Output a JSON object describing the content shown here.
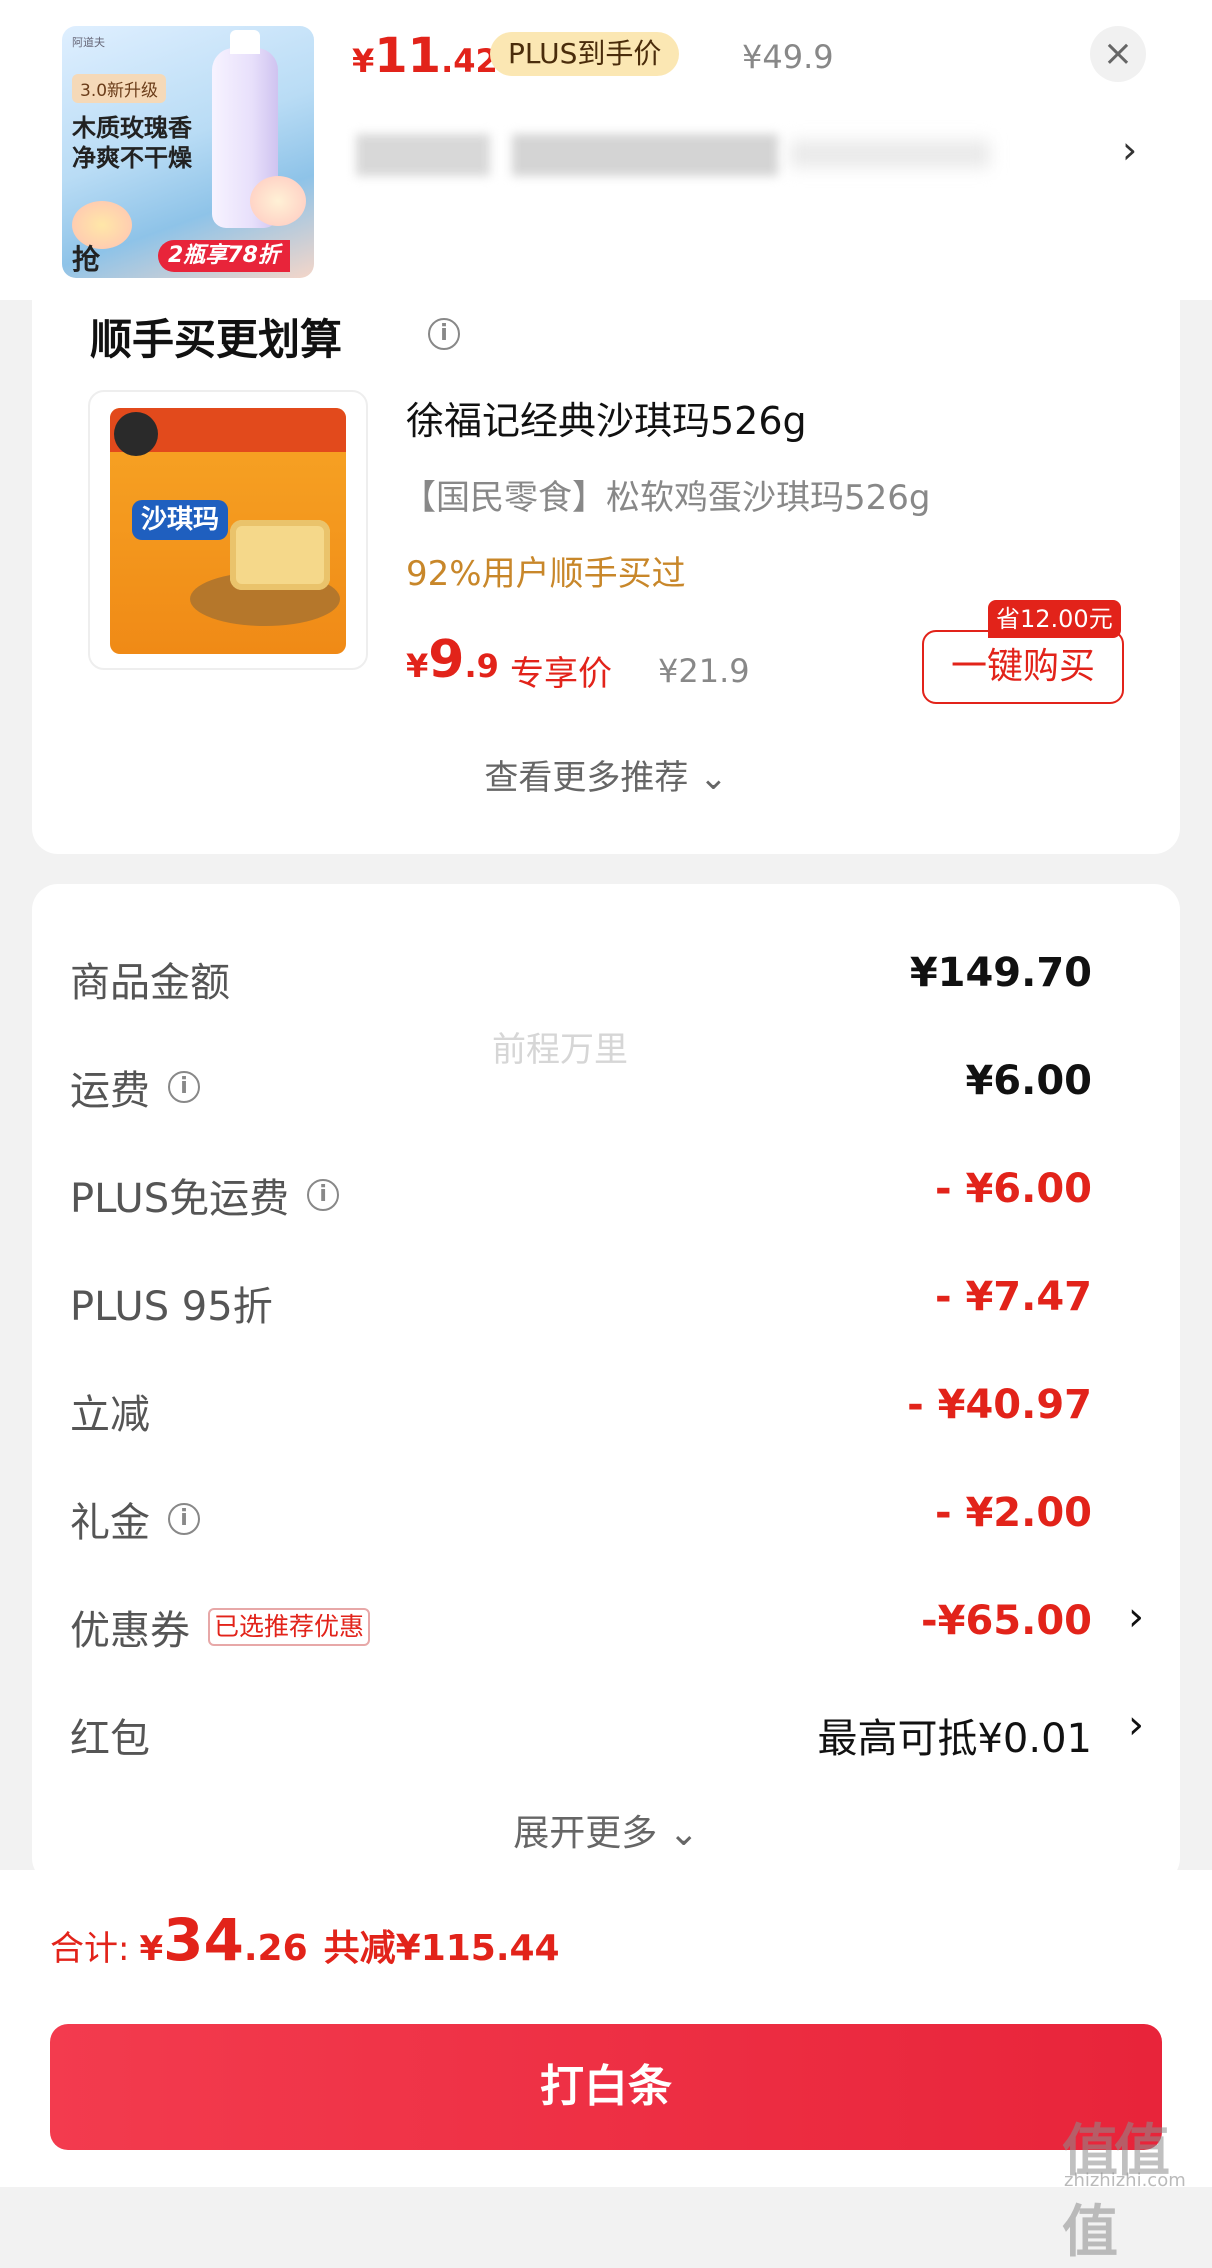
{
  "top": {
    "thumb": {
      "brand": "阿道夫",
      "badge": "3.0新升级",
      "line1": "木质玫瑰香",
      "line2": "净爽不干燥",
      "grab": "抢",
      "promo": "2瓶享78折"
    },
    "price_cur": "¥",
    "price_int": "11",
    "price_dec": ".42",
    "plus_tag": "PLUS到手价",
    "orig_price": "¥49.9",
    "close_icon": "×",
    "chevron": "›"
  },
  "reco": {
    "title": "顺手买更划算",
    "info": "i",
    "product": {
      "image_logo": "沙琪玛",
      "name": "徐福记经典沙琪玛526g",
      "desc": "【国民零食】松软鸡蛋沙琪玛526g",
      "pct": "92%用户顺手买过",
      "price_cur": "¥",
      "price_int": "9",
      "price_dec": ".9",
      "exclusive": "专享价",
      "orig": "¥21.9",
      "save_tag": "省12.00元",
      "buy_label": "一键购买"
    },
    "more": "查看更多推荐 ⌄"
  },
  "detail": {
    "rows": [
      {
        "label": "商品金额",
        "value": "¥149.70"
      },
      {
        "label": "运费",
        "value": "¥6.00"
      },
      {
        "label": "PLUS免运费",
        "value": "- ¥6.00"
      },
      {
        "label": "PLUS 95折",
        "value": "- ¥7.47"
      },
      {
        "label": "立减",
        "value": "- ¥40.97"
      },
      {
        "label": "礼金",
        "value": "- ¥2.00"
      },
      {
        "label": "优惠券",
        "tag": "已选推荐优惠",
        "value": "-¥65.00"
      },
      {
        "label": "红包",
        "value": "最高可抵¥0.01"
      }
    ],
    "watermark": "前程万里",
    "expand": "展开更多 ⌄"
  },
  "bottom": {
    "label": "合计:",
    "cur": "¥",
    "int": "34",
    "dec": ".26",
    "saved": "共减¥115.44",
    "pay_label": "打白条",
    "site_mark": "值值值",
    "site_url": "zhizhizhi.com"
  },
  "colors": {
    "accent_red": "#e2231a",
    "pay_button": "#e8243a",
    "plus_gold": "#fbe7b3"
  }
}
